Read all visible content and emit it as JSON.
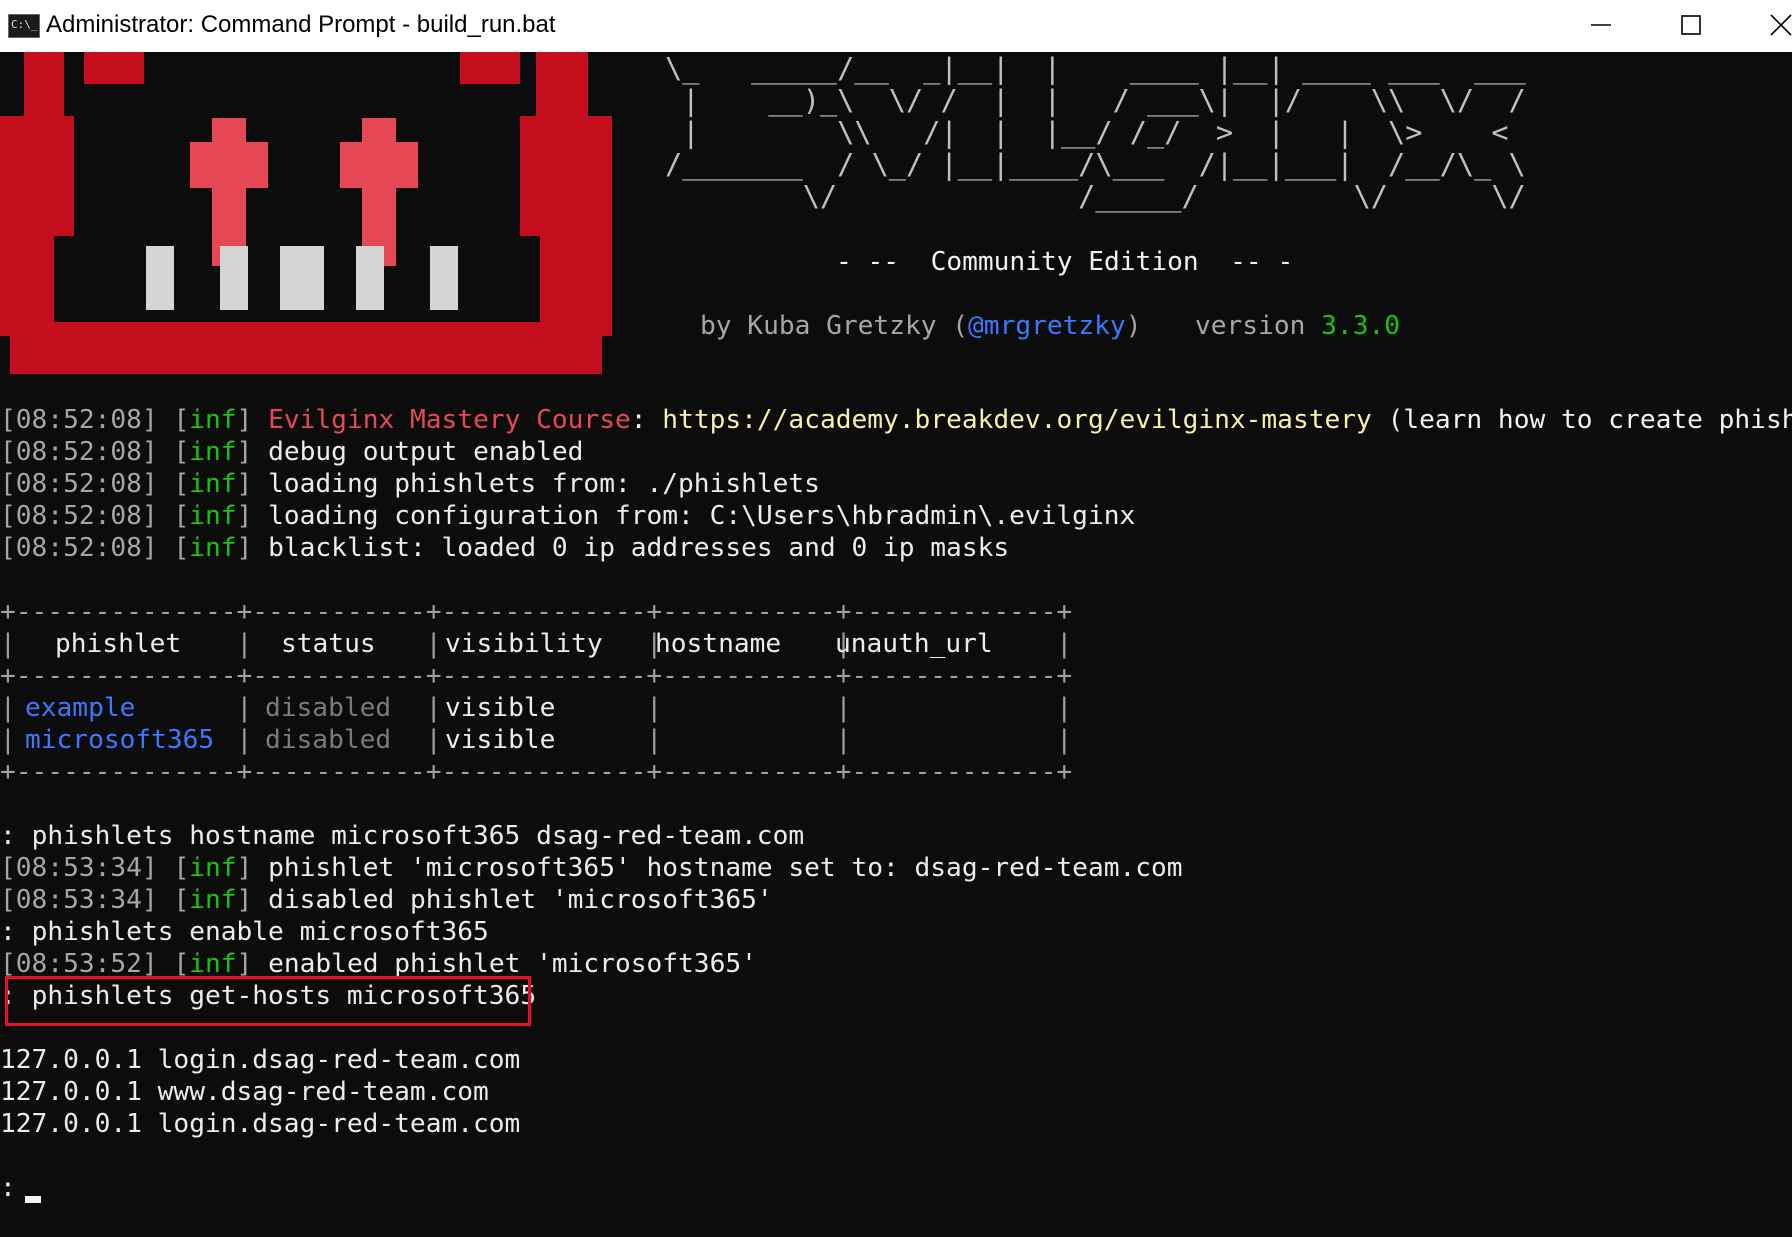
{
  "window": {
    "icon_text": "C:\\_",
    "title": "Administrator: Command Prompt - build_run.bat",
    "min_icon": "minimize-icon",
    "max_icon": "maximize-icon",
    "close_icon": "close-icon"
  },
  "colors": {
    "background": "#0c0c0c",
    "logo_red": "#c50f1f",
    "logo_eye": "#e74856",
    "highlight": "#e81123",
    "green": "#16c60c",
    "blue": "#3b78ff",
    "yellow": "#f9f1a5"
  },
  "banner": {
    "ascii": [
      "\\_   _____/__  _|__|  |    ____ |__| ____ ___  ___",
      " |    __)_\\  \\/ /  |  |   / ___\\|  |/    \\\\  \\/  /",
      " |        \\\\   /|  |  |__/ /_/  >  |   |  \\>    <",
      "/_______  / \\_/ |__|____/\\___  /|__|___|  /__/\\_ \\",
      "        \\/              /_____/         \\/      \\/"
    ],
    "edition": "- --  Community Edition  -- -",
    "by_prefix": "by Kuba Gretzky (",
    "handle": "@mrgretzky",
    "by_suffix": ")",
    "version_label": "version",
    "version": "3.3.0"
  },
  "log1": [
    {
      "ts": "[08:52:08]",
      "lvl": "[",
      "lvl_tag": "inf",
      "lvl_end": "]",
      "course_label": "Evilginx Mastery Course",
      "sep": ":",
      "url": "https://academy.breakdev.org/evilginx-mastery",
      "note": "(learn how to create phishlets)"
    },
    {
      "ts": "[08:52:08]",
      "lvl_tag": "inf",
      "msg": "debug output enabled"
    },
    {
      "ts": "[08:52:08]",
      "lvl_tag": "inf",
      "msg": "loading phishlets from: ./phishlets"
    },
    {
      "ts": "[08:52:08]",
      "lvl_tag": "inf",
      "msg": "loading configuration from: C:\\Users\\hbradmin\\.evilginx"
    },
    {
      "ts": "[08:52:08]",
      "lvl_tag": "inf",
      "msg": "blacklist: loaded 0 ip addresses and 0 ip masks"
    }
  ],
  "table": {
    "border": "+--------------+-----------+-------------+-----------+-------------+",
    "headers": [
      "phishlet",
      "status",
      "visibility",
      "hostname",
      "unauth_url"
    ],
    "rows": [
      {
        "phishlet": "example",
        "status": "disabled",
        "visibility": "visible",
        "hostname": "",
        "unauth_url": ""
      },
      {
        "phishlet": "microsoft365",
        "status": "disabled",
        "visibility": "visible",
        "hostname": "",
        "unauth_url": ""
      }
    ]
  },
  "session": {
    "prompt": ":",
    "cmd1": "phishlets hostname microsoft365 dsag-red-team.com",
    "log_a": {
      "ts": "[08:53:34]",
      "lvl_tag": "inf",
      "msg": "phishlet 'microsoft365' hostname set to: dsag-red-team.com"
    },
    "log_b": {
      "ts": "[08:53:34]",
      "lvl_tag": "inf",
      "msg": "disabled phishlet 'microsoft365'"
    },
    "cmd2": "phishlets enable microsoft365",
    "log_c": {
      "ts": "[08:53:52]",
      "lvl_tag": "inf",
      "msg": "enabled phishlet 'microsoft365'"
    },
    "cmd3": "phishlets get-hosts microsoft365",
    "hosts": [
      "127.0.0.1 login.dsag-red-team.com",
      "127.0.0.1 www.dsag-red-team.com",
      "127.0.0.1 login.dsag-red-team.com"
    ]
  }
}
